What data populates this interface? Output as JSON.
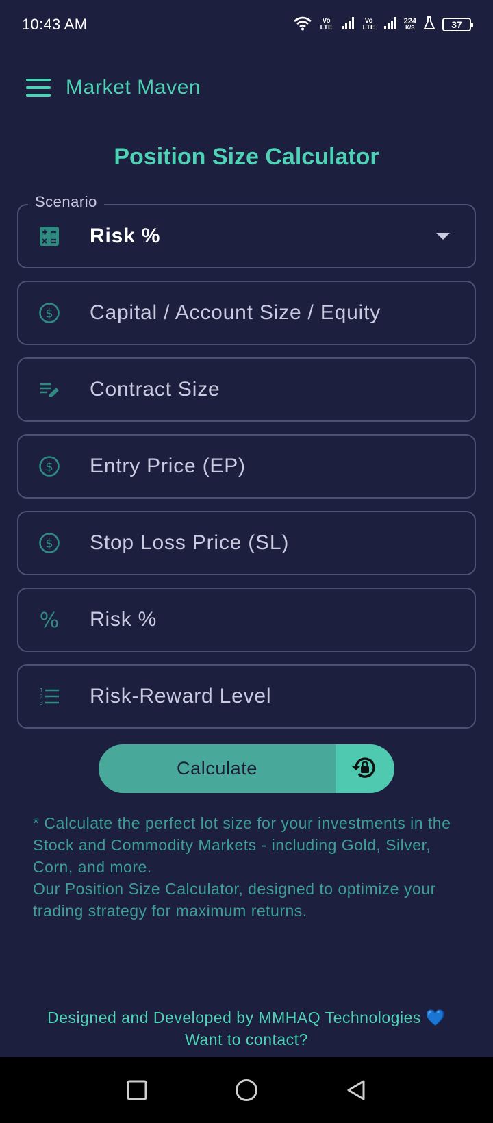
{
  "status_bar": {
    "time": "10:43 AM",
    "net1": "Vo LTE",
    "net2": "Vo LTE",
    "speed_value": "224",
    "speed_unit": "K/S",
    "battery": "37"
  },
  "app_bar": {
    "title": "Market Maven",
    "menu_icon": "hamburger-menu-icon"
  },
  "page": {
    "title": "Position Size Calculator"
  },
  "form": {
    "scenario": {
      "label": "Scenario",
      "selected": "Risk %",
      "icon": "calculator-icon"
    },
    "fields": [
      {
        "placeholder": "Capital / Account Size / Equity",
        "icon": "dollar-circle-icon"
      },
      {
        "placeholder": "Contract Size",
        "icon": "edit-note-icon"
      },
      {
        "placeholder": "Entry Price (EP)",
        "icon": "dollar-circle-icon"
      },
      {
        "placeholder": "Stop Loss Price (SL)",
        "icon": "dollar-circle-icon"
      },
      {
        "placeholder": "Risk %",
        "icon": "percent-icon"
      },
      {
        "placeholder": "Risk-Reward Level",
        "icon": "numbered-list-icon"
      }
    ]
  },
  "actions": {
    "calculate_label": "Calculate",
    "reset_icon": "lock-reset-icon"
  },
  "description": "* Calculate the perfect lot size for your investments in the Stock and Commodity Markets - including Gold, Silver, Corn, and more.\n Our Position Size Calculator, designed to optimize your trading strategy for maximum returns.",
  "footer": {
    "credit": "Designed and Developed by MMHAQ Technologies",
    "heart": "💙",
    "contact": "Want to contact?"
  },
  "colors": {
    "background": "#1c1f3d",
    "accent": "#4fd1b5",
    "button": "#48a99b",
    "border": "#4c5073"
  }
}
